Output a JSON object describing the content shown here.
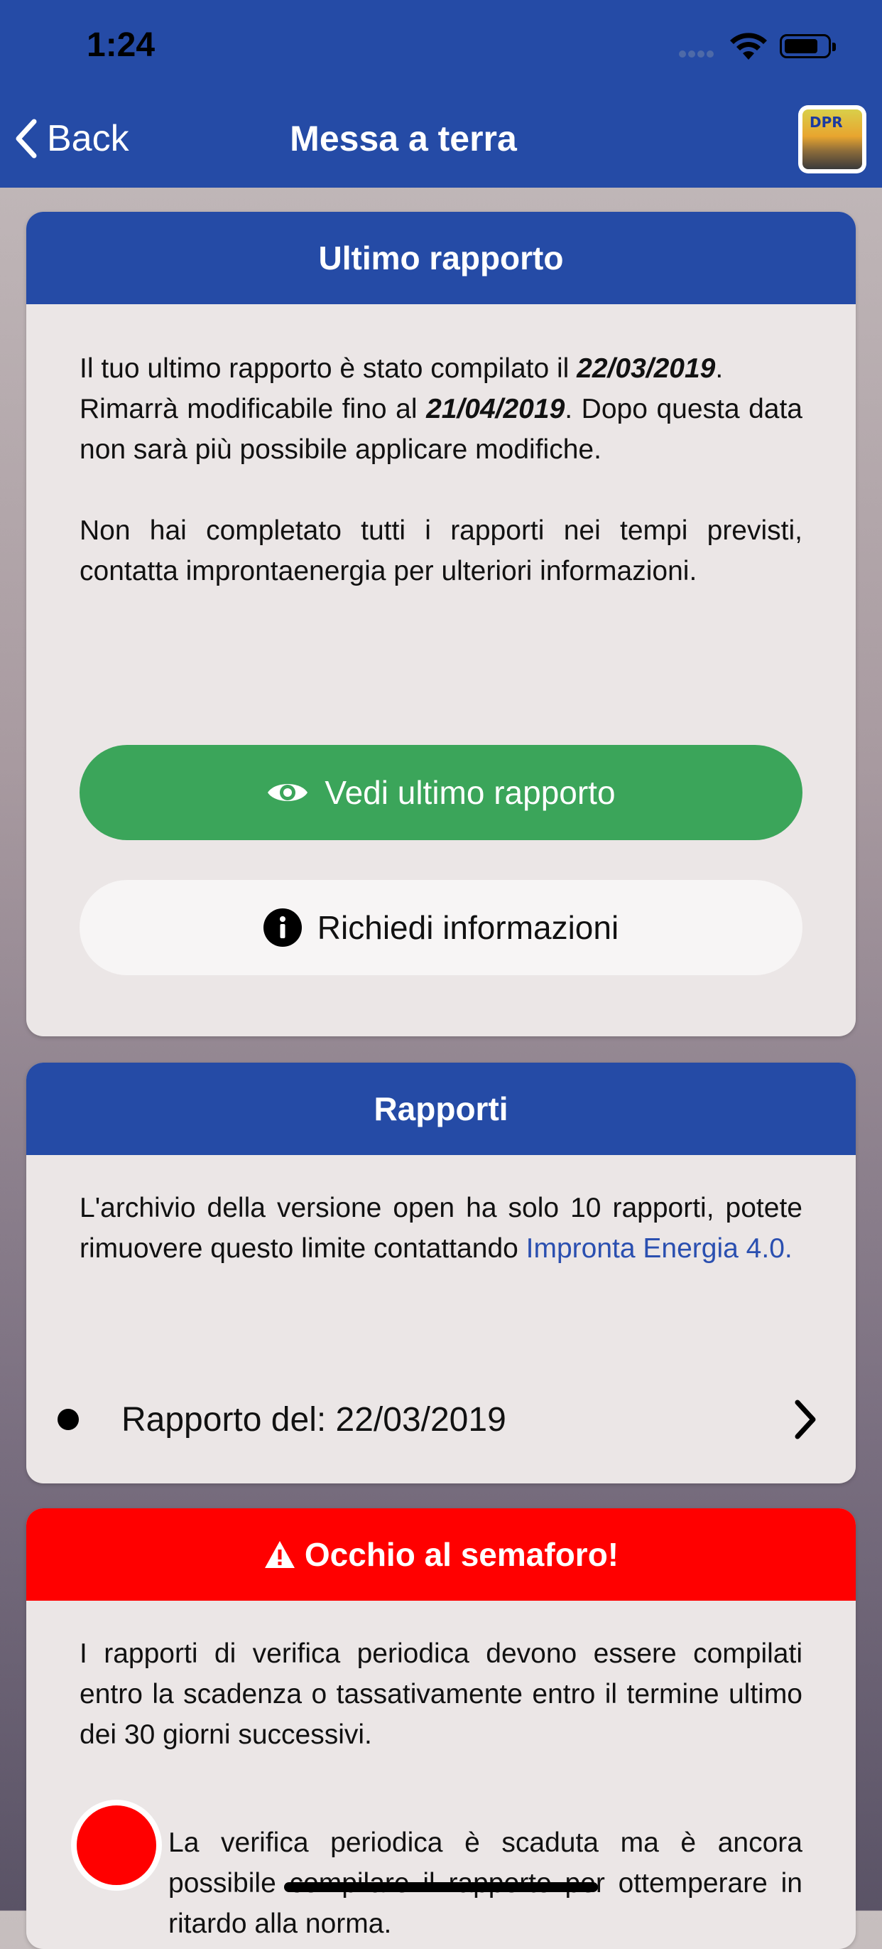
{
  "status_bar": {
    "time": "1:24"
  },
  "nav": {
    "back_label": "Back",
    "title": "Messa a terra"
  },
  "card_ultimo": {
    "header": "Ultimo rapporto",
    "p1_prefix": "Il tuo ultimo rapporto è stato compilato il ",
    "p1_date": "22/03/2019",
    "p1_suffix": ".",
    "p2_prefix": "Rimarrà modificabile fino al ",
    "p2_date": "21/04/2019",
    "p2_suffix": ". Dopo questa data non sarà più possibile applicare modifiche.",
    "p3": "Non hai completato tutti i rapporti nei tempi previsti, contatta improntaenergia per ulteriori informazioni.",
    "view_button": "Vedi ultimo rapporto",
    "info_button": "Richiedi informazioni"
  },
  "card_rapporti": {
    "header": "Rapporti",
    "text": "L'archivio della versione open ha solo 10 rapporti, potete rimuovere questo limite contattando ",
    "link": "Impronta Energia 4.0.",
    "items": [
      {
        "label": "Rapporto del: 22/03/2019"
      }
    ]
  },
  "card_semaforo": {
    "header": "Occhio al semaforo!",
    "text": "I rapporti di verifica periodica devono essere compilati entro la scadenza o tassativamente entro il termine ultimo dei 30 giorni successivi.",
    "light_red_text": "La verifica periodica è scaduta ma è ancora possibile compilare il rapporto per ottemperare in ritardo alla norma.",
    "colors": {
      "red": "#ff0000"
    }
  },
  "colors": {
    "brand_blue": "#254ba6",
    "green": "#3ba55a"
  }
}
